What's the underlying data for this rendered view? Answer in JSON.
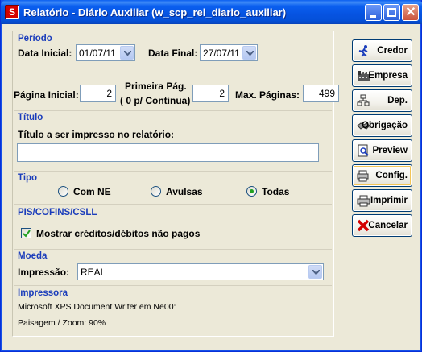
{
  "window": {
    "title": "Relatório - Diário Auxiliar (w_scp_rel_diario_auxiliar)",
    "app_icon_letter": "S"
  },
  "periodo": {
    "title": "Período",
    "data_inicial_label": "Data Inicial:",
    "data_inicial_value": "01/07/11",
    "data_final_label": "Data Final:",
    "data_final_value": "27/07/11"
  },
  "paginas": {
    "pagina_inicial_label": "Página Inicial:",
    "pagina_inicial_value": "2",
    "primeira_pag_label_line1": "Primeira Pág.",
    "primeira_pag_label_line2": "( 0 p/ Continua)",
    "primeira_pag_value": "2",
    "max_paginas_label": "Max. Páginas:",
    "max_paginas_value": "499"
  },
  "titulo": {
    "title": "Título",
    "label": "Título a ser impresso no relatório:",
    "value": ""
  },
  "tipo": {
    "title": "Tipo",
    "options": [
      "Com NE",
      "Avulsas",
      "Todas"
    ],
    "selected": "Todas"
  },
  "pis": {
    "title": "PIS/COFINS/CSLL",
    "checkbox_label": "Mostrar créditos/débitos não pagos",
    "checked": true
  },
  "moeda": {
    "title": "Moeda",
    "label": "Impressão:",
    "value": "REAL"
  },
  "impressora": {
    "title": "Impressora",
    "line1": "Microsoft XPS Document Writer em Ne00:",
    "line2": "Paisagem / Zoom: 90%"
  },
  "buttons": {
    "credor": "Credor",
    "empresa": "Empresa",
    "dep": "Dep.",
    "obrigacao": "Obrigação",
    "preview": "Preview",
    "config": "Config.",
    "imprimir": "Imprimir",
    "cancelar": "Cancelar"
  },
  "colors": {
    "section_title": "#1B3DBB",
    "titlebar": "#0653E1",
    "window_bg": "#ECE9D8"
  }
}
